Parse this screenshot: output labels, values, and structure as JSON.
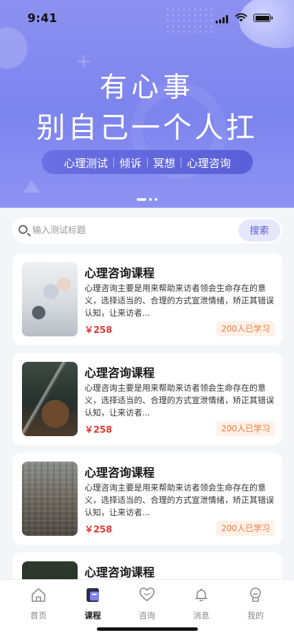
{
  "status_bar": {
    "time": "9:41"
  },
  "hero": {
    "line1": "有心事",
    "line2": "别自己一个人扛",
    "tags": [
      "心理测试",
      "倾诉",
      "冥想",
      "心理咨询"
    ]
  },
  "search": {
    "placeholder": "输入测试标题",
    "button": "搜索"
  },
  "courses": [
    {
      "title": "心理咨询课程",
      "desc": "心理咨询主要是用来帮助来访者领会生命存在的意义，选择适当的、合理的方式宣泄情绪，矫正其错误认知，让来访者...",
      "price": "￥258",
      "learners": "200人已学习"
    },
    {
      "title": "心理咨询课程",
      "desc": "心理咨询主要是用来帮助来访者领会生命存在的意义，选择适当的、合理的方式宣泄情绪，矫正其错误认知，让来访者...",
      "price": "￥258",
      "learners": "200人已学习"
    },
    {
      "title": "心理咨询课程",
      "desc": "心理咨询主要是用来帮助来访者领会生命存在的意义，选择适当的、合理的方式宣泄情绪，矫正其错误认知，让来访者...",
      "price": "￥258",
      "learners": "200人已学习"
    },
    {
      "title": "心理咨询课程"
    }
  ],
  "tabbar": {
    "items": [
      {
        "label": "首页",
        "icon": "home-icon"
      },
      {
        "label": "课程",
        "icon": "course-icon",
        "active": true
      },
      {
        "label": "咨询",
        "icon": "heart-icon"
      },
      {
        "label": "消息",
        "icon": "bell-icon"
      },
      {
        "label": "我的",
        "icon": "profile-icon"
      }
    ]
  },
  "colors": {
    "accent": "#5A5FD6",
    "price": "#E53935",
    "badge_text": "#F07A3A"
  }
}
